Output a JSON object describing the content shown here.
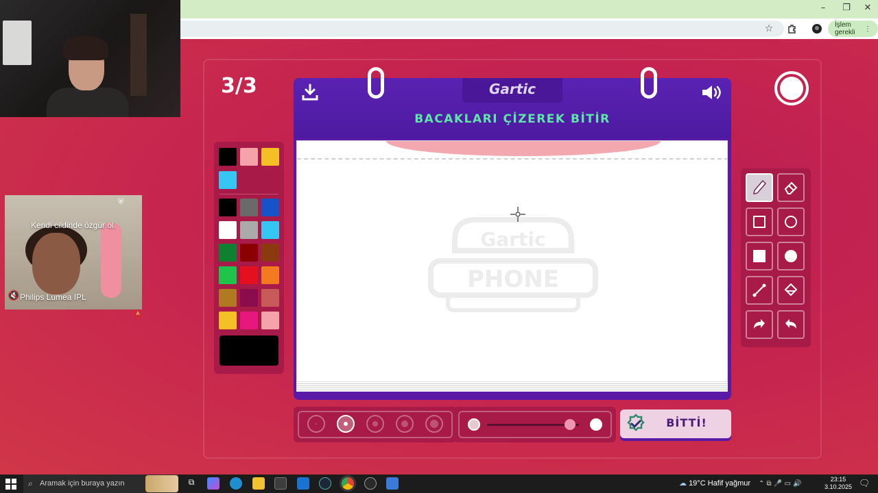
{
  "browser": {
    "action_badge": "İşlem gerekli"
  },
  "ad": {
    "headline": "Kendi cildinde özgür ol.",
    "product": "Philips Lumea IPL",
    "badge": "A"
  },
  "game": {
    "round": "3/3",
    "logo": "Gartic",
    "task": "BACAKLARI ÇİZEREK BİTİR",
    "watermark_top": "Gartic",
    "watermark_bottom": "PHONE",
    "done_label": "BİTTİ!",
    "palette": {
      "recent": [
        "#000000",
        "#f5a3a8",
        "#f4c025",
        "#35c6f4"
      ],
      "colors": [
        "#000000",
        "#6a6a6a",
        "#1652c8",
        "#ffffff",
        "#aaaaaa",
        "#35c6f4",
        "#0e8030",
        "#8b0000",
        "#8b3a10",
        "#1fc54a",
        "#e5101d",
        "#f47a1f",
        "#b07a22",
        "#8c0b4a",
        "#c85a5a",
        "#f4c025",
        "#e8177e",
        "#f5a3a8"
      ],
      "current": "#000000"
    },
    "tools": [
      "pencil-icon",
      "eraser-icon",
      "rectangle-outline-icon",
      "circle-outline-icon",
      "rectangle-filled-icon",
      "circle-filled-icon",
      "line-icon",
      "fill-bucket-icon",
      "undo-icon",
      "redo-icon"
    ],
    "active_tool": "pencil-icon",
    "brush_sizes": 5,
    "selected_size_index": 1,
    "opacity": 0.9
  },
  "taskbar": {
    "search_placeholder": "Aramak için buraya yazın",
    "weather": "19°C  Hafif yağmur",
    "time": "23:15",
    "date": "3.10.2025"
  }
}
